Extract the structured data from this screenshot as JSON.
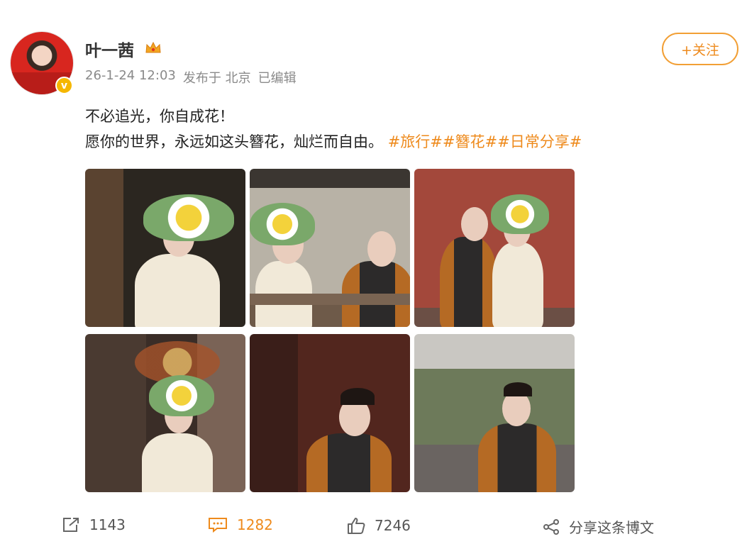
{
  "user": {
    "name": "叶一茜",
    "badge_icon": "crown-icon",
    "verified_icon": "verified-v-icon",
    "verified_mark": "v"
  },
  "meta": {
    "time": "26-1-24 12:03",
    "location": "发布于 北京",
    "edited": "已编辑"
  },
  "follow": {
    "label": "+关注"
  },
  "post": {
    "line1": "不必追光，你自成花！",
    "line2": "愿你的世界，永远如这头簪花，灿烂而自由。",
    "hashtags": [
      "#旅行#",
      "#簪花#",
      "#日常分享#"
    ]
  },
  "photos_count": 6,
  "actions": {
    "repost": "1143",
    "comment": "1282",
    "like": "7246",
    "share": "分享这条博文"
  },
  "colors": {
    "accent": "#ee8a1c",
    "verified": "#f5b700",
    "meta_text": "#8a8a8a"
  }
}
